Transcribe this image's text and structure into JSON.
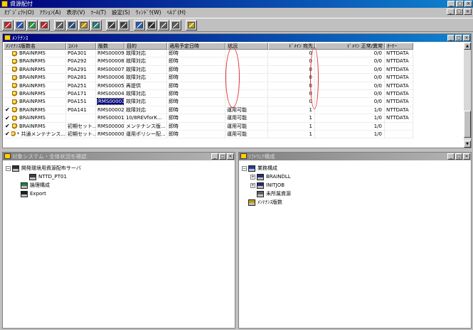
{
  "app": {
    "title": "資源配付"
  },
  "menu": [
    {
      "label": "ｵﾌﾞｼﾞｪｸﾄ(O)",
      "name": "object"
    },
    {
      "label": "ｱｸｼｮﾝ(A)",
      "name": "action"
    },
    {
      "label": "表示(V)",
      "name": "view"
    },
    {
      "label": "ﾂｰﾙ(T)",
      "name": "tool"
    },
    {
      "label": "設定(S)",
      "name": "settings"
    },
    {
      "label": "ｳｨﾝﾄﾞｳ(W)",
      "name": "window"
    },
    {
      "label": "ﾍﾙﾌﾟ(H)",
      "name": "help"
    }
  ],
  "toolbar": {
    "buttons": [
      "tb-network-1",
      "tb-network-2",
      "tb-network-3",
      "tb-network-4",
      "tb-list",
      "tb-book",
      "tb-key",
      "tb-grid",
      "tb-copy",
      "tb-paste",
      "tb-user",
      "tb-monitor",
      "tb-window",
      "tb-properties",
      "tb-help"
    ]
  },
  "maint_panel": {
    "title": "ﾒﾝﾃﾅﾝｽ",
    "columns": [
      "ﾒﾝﾃﾅﾝｽ版数名",
      "ｺﾒﾝﾄ",
      "版数",
      "目的",
      "適用予定日時",
      "状況",
      "ﾄﾞﾒｲﾝ 宛先",
      "ﾄﾞﾒｲﾝ 正常/異常",
      "ｵｰﾅｰ"
    ],
    "rows": [
      {
        "check": "",
        "name": "BRAINRMS",
        "comment": "P0A301",
        "version": "RMS00009",
        "purpose": "故障対応",
        "schedule": "即時",
        "status": "",
        "dest": "0",
        "ratio": "0/0",
        "owner": "NTTDATA",
        "selected": false
      },
      {
        "check": "",
        "name": "BRAINRMS",
        "comment": "P0A292",
        "version": "RMS00008",
        "purpose": "故障対応",
        "schedule": "即時",
        "status": "",
        "dest": "0",
        "ratio": "0/0",
        "owner": "NTTDATA",
        "selected": false
      },
      {
        "check": "",
        "name": "BRAINRMS",
        "comment": "P0A291",
        "version": "RMS00007",
        "purpose": "故障対応",
        "schedule": "即時",
        "status": "",
        "dest": "0",
        "ratio": "0/0",
        "owner": "NTTDATA",
        "selected": false
      },
      {
        "check": "",
        "name": "BRAINRMS",
        "comment": "P0A281",
        "version": "RMS00006",
        "purpose": "故障対応",
        "schedule": "即時",
        "status": "",
        "dest": "0",
        "ratio": "0/0",
        "owner": "NTTDATA",
        "selected": false
      },
      {
        "check": "",
        "name": "BRAINRMS",
        "comment": "P0A251",
        "version": "RMS00005",
        "purpose": "再提供",
        "schedule": "即時",
        "status": "",
        "dest": "0",
        "ratio": "0/0",
        "owner": "NTTDATA",
        "selected": false
      },
      {
        "check": "",
        "name": "BRAINRMS",
        "comment": "P0A171",
        "version": "RMS00004",
        "purpose": "故障対応",
        "schedule": "即時",
        "status": "",
        "dest": "0",
        "ratio": "0/0",
        "owner": "NTTDATA",
        "selected": false
      },
      {
        "check": "",
        "name": "BRAINRMS",
        "comment": "P0A151",
        "version": "RMS00003",
        "purpose": "故障対応",
        "schedule": "即時",
        "status": "",
        "dest": "0",
        "ratio": "0/0",
        "owner": "NTTDATA",
        "selected": true
      },
      {
        "check": "✔",
        "name": "BRAINRMS",
        "comment": "P0A141",
        "version": "RMS00002",
        "purpose": "故障対応",
        "schedule": "即時",
        "status": "運用可能",
        "dest": "1",
        "ratio": "1/0",
        "owner": "NTTDATA",
        "selected": false
      },
      {
        "check": "✔",
        "name": "BRAINRMS",
        "comment": "",
        "version": "RMS00001",
        "purpose": "10/8REVforK...",
        "schedule": "即時",
        "status": "運用可能",
        "dest": "1",
        "ratio": "1/0",
        "owner": "NTTDATA",
        "selected": false
      },
      {
        "check": "✔",
        "name": "BRAINRMS",
        "comment": "初期セット...",
        "version": "RMS00000",
        "purpose": "メンテナンス版...",
        "schedule": "即時",
        "status": "運用可能",
        "dest": "1",
        "ratio": "1/0",
        "owner": "",
        "selected": false
      },
      {
        "check": "✔",
        "name": "* 共通メンテナンス...",
        "comment": "初期セット...",
        "version": "RMS00000",
        "purpose": "運用ポリシー配...",
        "schedule": "即時",
        "status": "運用可能",
        "dest": "1",
        "ratio": "1/0",
        "owner": "",
        "selected": false
      }
    ]
  },
  "target_panel": {
    "title": "対象システム・全体状況を確認",
    "nodes": [
      {
        "label": "開発環境用資源配布サーバ",
        "icon": "server-icon",
        "level": 0,
        "expander": "−"
      },
      {
        "label": "NTTD_PT01",
        "icon": "computer-icon",
        "level": 2,
        "expander": ""
      },
      {
        "label": "論理構成",
        "icon": "logical-config-icon",
        "level": 1,
        "expander": ""
      },
      {
        "label": "Export",
        "icon": "export-icon",
        "level": 1,
        "expander": ""
      }
    ]
  },
  "software_panel": {
    "title": "ｿﾌﾄｳｪｱ構成",
    "nodes": [
      {
        "label": "業務構成",
        "icon": "business-config-icon",
        "level": 0,
        "expander": "−"
      },
      {
        "label": "BRAINDLL",
        "icon": "package-icon",
        "level": 1,
        "expander": "+"
      },
      {
        "label": "INITJOB",
        "icon": "package-icon",
        "level": 1,
        "expander": "+"
      },
      {
        "label": "未所属資源",
        "icon": "unassigned-resource-icon",
        "level": 1,
        "expander": ""
      },
      {
        "label": "ﾒﾝﾃﾅﾝｽ版数",
        "icon": "maintenance-version-icon",
        "level": 0,
        "expander": ""
      }
    ]
  },
  "colors": {
    "titlebar": "#00007b",
    "face": "#c0c0c0",
    "annotation": "#e03030"
  }
}
